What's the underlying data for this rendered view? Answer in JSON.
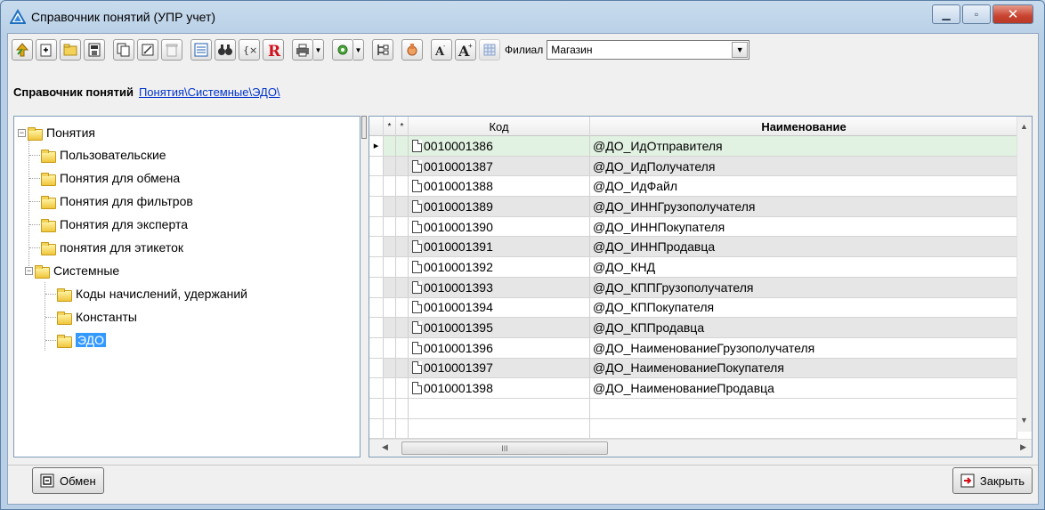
{
  "window": {
    "title": "Справочник понятий (УПР учет)"
  },
  "toolbar": {
    "icons": [
      "up-arrow-icon",
      "new-item-icon",
      "new-folder-icon",
      "save-icon",
      "copy-icon",
      "edit-icon",
      "delete-icon",
      "list-view-icon",
      "binoculars-icon",
      "brackets-icon",
      "report-r-icon",
      "print-icon",
      "tools-icon",
      "tree-icon",
      "hand-icon",
      "font-decrease-icon",
      "font-increase-icon",
      "grid-icon"
    ],
    "branch_label": "Филиал",
    "branch_value": "Магазин"
  },
  "breadcrumb": {
    "title": "Справочник понятий",
    "path": "Понятия\\Системные\\ЭДО\\"
  },
  "tree": {
    "root": "Понятия",
    "children": [
      "Пользовательские",
      "Понятия для обмена",
      "Понятия для фильтров",
      "Понятия для эксперта",
      "понятия для этикеток",
      "Системные"
    ],
    "system_children": [
      "Коды начислений, удержаний",
      "Константы",
      "ЭДО"
    ]
  },
  "grid": {
    "columns": [
      "*",
      "*",
      "Код",
      "Наименование"
    ],
    "rows": [
      {
        "code": "0010001386",
        "name": "@ДО_ИдОтправителя"
      },
      {
        "code": "0010001387",
        "name": "@ДО_ИдПолучателя"
      },
      {
        "code": "0010001388",
        "name": "@ДО_ИдФайл"
      },
      {
        "code": "0010001389",
        "name": "@ДО_ИННГрузополучателя"
      },
      {
        "code": "0010001390",
        "name": "@ДО_ИННПокупателя"
      },
      {
        "code": "0010001391",
        "name": "@ДО_ИННПродавца"
      },
      {
        "code": "0010001392",
        "name": "@ДО_КНД"
      },
      {
        "code": "0010001393",
        "name": "@ДО_КППГрузополучателя"
      },
      {
        "code": "0010001394",
        "name": "@ДО_КППокупателя"
      },
      {
        "code": "0010001395",
        "name": "@ДО_КППродавца"
      },
      {
        "code": "0010001396",
        "name": "@ДО_НаименованиеГрузополучателя"
      },
      {
        "code": "0010001397",
        "name": "@ДО_НаименованиеПокупателя"
      },
      {
        "code": "0010001398",
        "name": "@ДО_НаименованиеПродавца"
      }
    ],
    "scroll_thumb": "III"
  },
  "buttons": {
    "exchange": "Обмен",
    "close": "Закрыть"
  }
}
